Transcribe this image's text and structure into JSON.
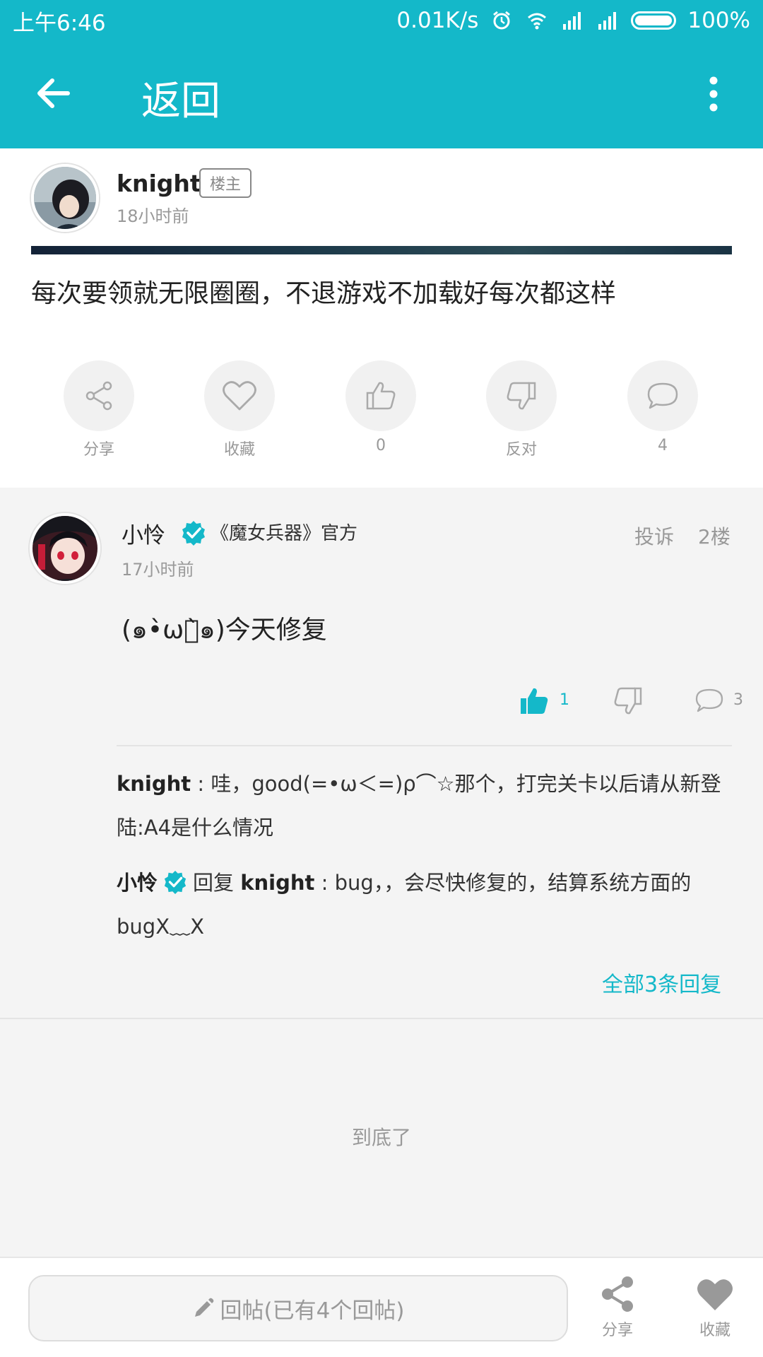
{
  "status_bar": {
    "time": "上午6:46",
    "network_speed": "0.01K/s",
    "battery": "100%",
    "icons": [
      "alarm-icon",
      "wifi-icon",
      "signal-icon",
      "signal-icon",
      "battery-icon"
    ]
  },
  "app_bar": {
    "back_icon": "arrow-left-icon",
    "title": "返回",
    "menu_icon": "more-vertical-icon"
  },
  "post": {
    "author": "knight",
    "badge": "楼主",
    "time": "18小时前",
    "content": "每次要领就无限圈圈，不退游戏不加载好每次都这样",
    "actions": [
      {
        "icon": "share-icon",
        "label": "分享"
      },
      {
        "icon": "heart-icon",
        "label": "收藏"
      },
      {
        "icon": "thumbs-up-icon",
        "label": "0"
      },
      {
        "icon": "thumbs-down-icon",
        "label": "反对"
      },
      {
        "icon": "comment-icon",
        "label": "4"
      }
    ]
  },
  "comment": {
    "author": "小怜",
    "tag": "《魔女兵器》官方",
    "time": "17小时前",
    "report": "投诉",
    "floor": "2楼",
    "content": "(๑•̀ωก̀๑)今天修复",
    "like_count": "1",
    "reply_count": "3",
    "replies": [
      {
        "author": "knight",
        "sep": " : ",
        "text": "哇，good(=•ω＜=)ρ⌒☆那个，打完关卡以后请从新登陆:A4是什么情况"
      },
      {
        "author": "小怜",
        "reply_word": "回复",
        "target": "knight",
        "sep": " : ",
        "text": "bug，，会尽快修复的，结算系统方面的bugX﹏X"
      }
    ],
    "all_replies": "全部3条回复"
  },
  "end_text": "到底了",
  "bottom_bar": {
    "reply_placeholder": "回帖(已有4个回帖)",
    "share_label": "分享",
    "favorite_label": "收藏"
  },
  "colors": {
    "accent": "#14b8c9",
    "muted_text": "#999999",
    "background": "#f4f4f4"
  }
}
